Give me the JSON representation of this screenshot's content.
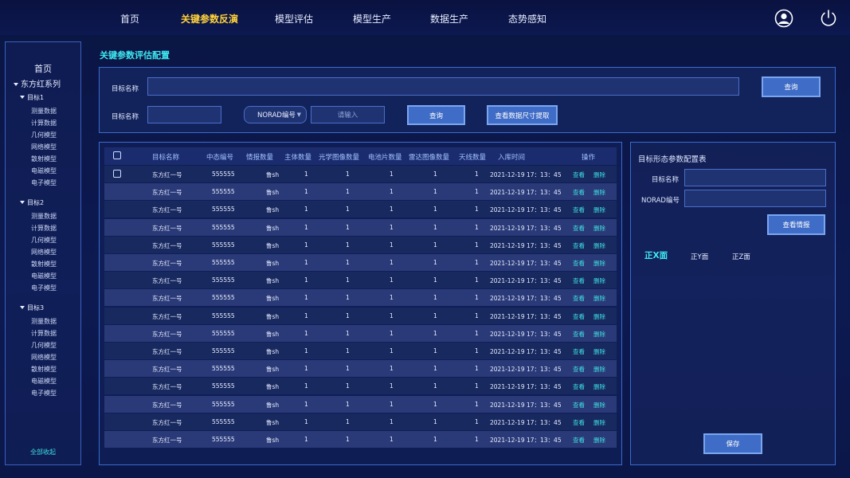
{
  "nav": {
    "items": [
      "首页",
      "关键参数反演",
      "模型评估",
      "模型生产",
      "数据生产",
      "态势感知"
    ],
    "active_index": 1
  },
  "sidebar": {
    "home": "首页",
    "series": "东方红系列",
    "targets": [
      {
        "label": "目标1",
        "items": [
          "测量数据",
          "计算数据",
          "几何模型",
          "网络模型",
          "散射模型",
          "电磁模型",
          "电子模型"
        ]
      },
      {
        "label": "目标2",
        "items": [
          "测量数据",
          "计算数据",
          "几何模型",
          "网络模型",
          "散射模型",
          "电磁模型",
          "电子模型"
        ]
      },
      {
        "label": "目标3",
        "items": [
          "测量数据",
          "计算数据",
          "几何模型",
          "网络模型",
          "散射模型",
          "电磁模型",
          "电子模型"
        ]
      }
    ],
    "collapse_all": "全部收起"
  },
  "page_title": "关键参数评估配置",
  "search": {
    "target_name_label": "目标名称",
    "target_name2_label": "目标名称",
    "query_button": "查询",
    "norad_select": "NORAD编号",
    "input_placeholder": "请输入",
    "query_button2": "查询",
    "size_extract_button": "查看数据尺寸提取"
  },
  "table": {
    "headers": [
      "目标名称",
      "中态编号",
      "情报数量",
      "主体数量",
      "光学图像数量",
      "电池片数量",
      "雷达图像数量",
      "天线数量",
      "入库时间",
      "操作"
    ],
    "rows": [
      {
        "name": "东方红一号",
        "id": "555555",
        "info": "鲁sh",
        "body": "1",
        "optical": "1",
        "cell": "1",
        "radar": "1",
        "antenna": "1",
        "time": "2021-12-19 17：13：45"
      },
      {
        "name": "东方红一号",
        "id": "555555",
        "info": "鲁sh",
        "body": "1",
        "optical": "1",
        "cell": "1",
        "radar": "1",
        "antenna": "1",
        "time": "2021-12-19 17：13：45"
      },
      {
        "name": "东方红一号",
        "id": "555555",
        "info": "鲁sh",
        "body": "1",
        "optical": "1",
        "cell": "1",
        "radar": "1",
        "antenna": "1",
        "time": "2021-12-19 17：13：45"
      },
      {
        "name": "东方红一号",
        "id": "555555",
        "info": "鲁sh",
        "body": "1",
        "optical": "1",
        "cell": "1",
        "radar": "1",
        "antenna": "1",
        "time": "2021-12-19 17：13：45"
      },
      {
        "name": "东方红一号",
        "id": "555555",
        "info": "鲁sh",
        "body": "1",
        "optical": "1",
        "cell": "1",
        "radar": "1",
        "antenna": "1",
        "time": "2021-12-19 17：13：45"
      },
      {
        "name": "东方红一号",
        "id": "555555",
        "info": "鲁sh",
        "body": "1",
        "optical": "1",
        "cell": "1",
        "radar": "1",
        "antenna": "1",
        "time": "2021-12-19 17：13：45"
      },
      {
        "name": "东方红一号",
        "id": "555555",
        "info": "鲁sh",
        "body": "1",
        "optical": "1",
        "cell": "1",
        "radar": "1",
        "antenna": "1",
        "time": "2021-12-19 17：13：45"
      },
      {
        "name": "东方红一号",
        "id": "555555",
        "info": "鲁sh",
        "body": "1",
        "optical": "1",
        "cell": "1",
        "radar": "1",
        "antenna": "1",
        "time": "2021-12-19 17：13：45"
      },
      {
        "name": "东方红一号",
        "id": "555555",
        "info": "鲁sh",
        "body": "1",
        "optical": "1",
        "cell": "1",
        "radar": "1",
        "antenna": "1",
        "time": "2021-12-19 17：13：45"
      },
      {
        "name": "东方红一号",
        "id": "555555",
        "info": "鲁sh",
        "body": "1",
        "optical": "1",
        "cell": "1",
        "radar": "1",
        "antenna": "1",
        "time": "2021-12-19 17：13：45"
      },
      {
        "name": "东方红一号",
        "id": "555555",
        "info": "鲁sh",
        "body": "1",
        "optical": "1",
        "cell": "1",
        "radar": "1",
        "antenna": "1",
        "time": "2021-12-19 17：13：45"
      },
      {
        "name": "东方红一号",
        "id": "555555",
        "info": "鲁sh",
        "body": "1",
        "optical": "1",
        "cell": "1",
        "radar": "1",
        "antenna": "1",
        "time": "2021-12-19 17：13：45"
      },
      {
        "name": "东方红一号",
        "id": "555555",
        "info": "鲁sh",
        "body": "1",
        "optical": "1",
        "cell": "1",
        "radar": "1",
        "antenna": "1",
        "time": "2021-12-19 17：13：45"
      },
      {
        "name": "东方红一号",
        "id": "555555",
        "info": "鲁sh",
        "body": "1",
        "optical": "1",
        "cell": "1",
        "radar": "1",
        "antenna": "1",
        "time": "2021-12-19 17：13：45"
      },
      {
        "name": "东方红一号",
        "id": "555555",
        "info": "鲁sh",
        "body": "1",
        "optical": "1",
        "cell": "1",
        "radar": "1",
        "antenna": "1",
        "time": "2021-12-19 17：13：45"
      },
      {
        "name": "东方红一号",
        "id": "555555",
        "info": "鲁sh",
        "body": "1",
        "optical": "1",
        "cell": "1",
        "radar": "1",
        "antenna": "1",
        "time": "2021-12-19 17：13：45"
      }
    ],
    "view_label": "查看",
    "delete_label": "删除"
  },
  "config_panel": {
    "title": "目标形态参数配置表",
    "target_name_label": "目标名称",
    "norad_label": "NORAD编号",
    "view_info_button": "查看情报",
    "faces": [
      "正X面",
      "正Y面",
      "正Z面"
    ],
    "active_face": 0,
    "save_button": "保存"
  },
  "colors": {
    "accent": "#3ee8f0",
    "nav_active": "#ffd23a",
    "button": "#3f6cc6"
  }
}
